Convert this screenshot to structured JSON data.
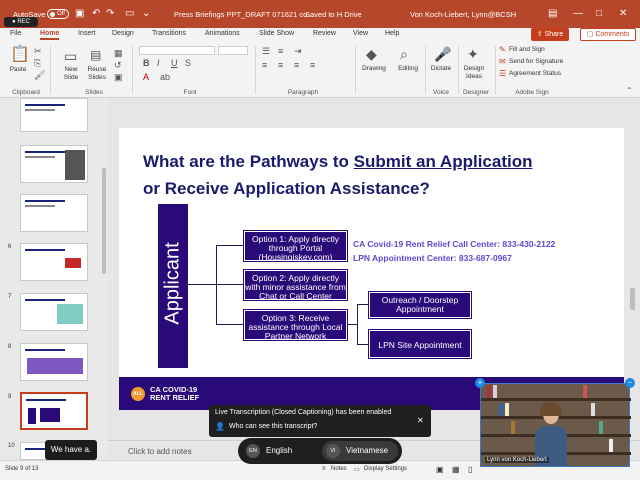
{
  "titlebar": {
    "autosave_label": "AutoSave",
    "autosave_state": "Off",
    "rec_label": "REC",
    "document_title": "Press Briefings PPT_DRAFT 071621 co...",
    "save_status": "Saved to H Drive",
    "user_name": "Von Koch-Liebert, Lynn@BCSH"
  },
  "menu": {
    "tabs": [
      "File",
      "Home",
      "Insert",
      "Design",
      "Transitions",
      "Animations",
      "Slide Show",
      "Review",
      "View",
      "Help"
    ],
    "active_tab": "Home",
    "share_label": "Share",
    "comments_label": "Comments"
  },
  "ribbon": {
    "paste_label": "Paste",
    "new_slide_label": "New Slide",
    "reuse_slides_label": "Reuse Slides",
    "drawing_label": "Drawing",
    "editing_label": "Editing",
    "dictate_label": "Dictate",
    "design_ideas_label": "Design Ideas",
    "fill_sign_label": "Fill and Sign",
    "send_signature_label": "Send for Signature",
    "agreement_status_label": "Agreement Status",
    "groups": {
      "clipboard": "Clipboard",
      "slides": "Slides",
      "font": "Font",
      "paragraph": "Paragraph",
      "voice": "Voice",
      "designer": "Designer",
      "adobe_sign": "Adobe Sign"
    }
  },
  "thumbnails": [
    {
      "num": "",
      "selected": false
    },
    {
      "num": "",
      "selected": false
    },
    {
      "num": "",
      "selected": false
    },
    {
      "num": "6",
      "selected": false
    },
    {
      "num": "7",
      "selected": false
    },
    {
      "num": "8",
      "selected": false
    },
    {
      "num": "9",
      "selected": true
    },
    {
      "num": "10",
      "selected": false
    }
  ],
  "slide": {
    "title_part1": "What are the Pathways to ",
    "title_underlined": "Submit an Application",
    "title_part2": "or Receive Application Assistance?",
    "applicant_label": "Applicant",
    "option1": "Option 1: Apply directly through Portal (Housingiskey.com)",
    "option2": "Option 2: Apply directly with minor assistance from Chat or Call Center",
    "option3": "Option 3: Receive assistance through Local Partner Network",
    "call_center": "CA Covid-19 Rent Relief Call Center: 833-430-2122",
    "lpn_center": "LPN Appointment Center: 833-687-0967",
    "outreach": "Outreach / Doorstep Appointment",
    "lpn_site": "LPN Site Appointment",
    "logo_badge": "ALL",
    "logo_line1": "CA COVID-19",
    "logo_line2": "RENT RELIEF"
  },
  "notes": {
    "placeholder": "Click to add notes"
  },
  "status": {
    "slide_position": "Slide 9 of 13",
    "notes_label": "Notes",
    "display_settings_label": "Display Settings"
  },
  "captions": {
    "live_caption": "We have a."
  },
  "toast": {
    "title": "Live Transcription (Closed Captioning) has been enabled",
    "question": "Who can see this transcript?"
  },
  "languages": [
    {
      "code": "EN",
      "label": "English"
    },
    {
      "code": "VI",
      "label": "Vietnamese"
    }
  ],
  "video": {
    "participant_name": "Lynn von Koch-Liebert"
  },
  "colors": {
    "accent": "#b7472a",
    "slide_purple": "#2a0a78",
    "info_text": "#5a4bd0"
  }
}
